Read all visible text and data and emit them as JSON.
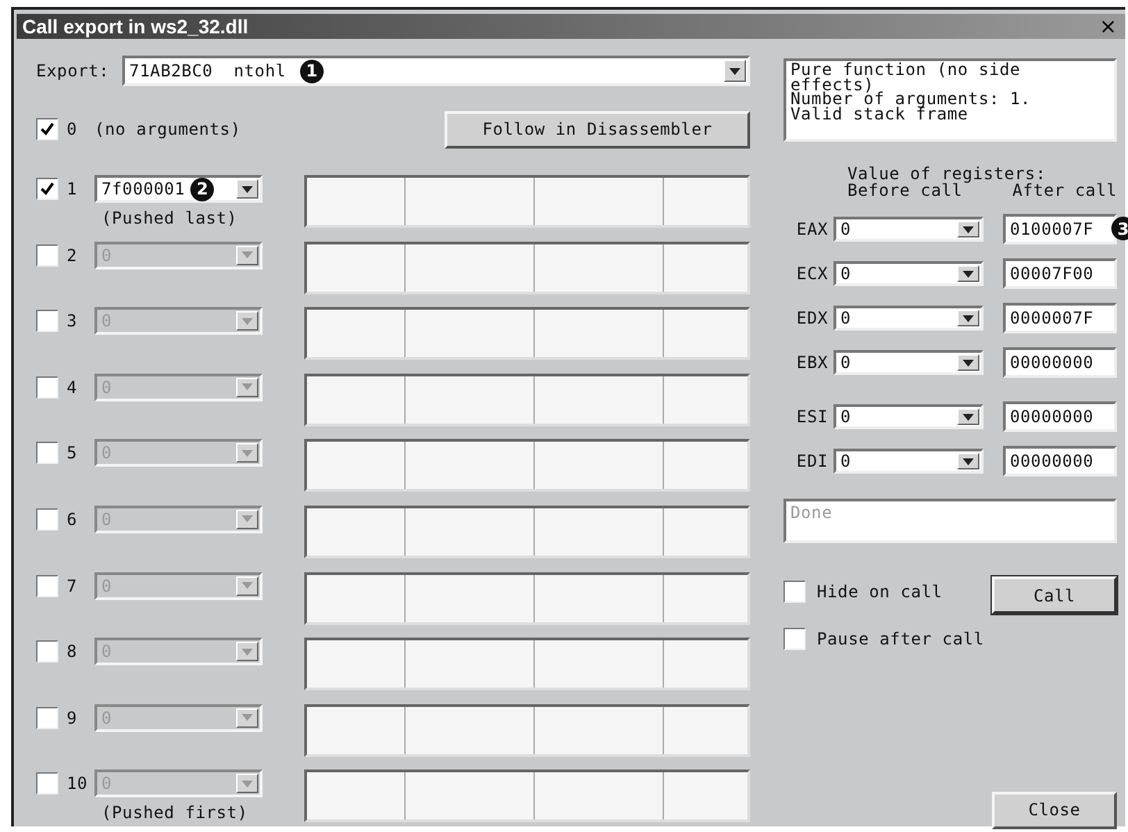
{
  "window": {
    "title": "Call export in ws2_32.dll",
    "close": "×"
  },
  "export": {
    "label": "Export:",
    "value": "71AB2BC0  ntohl",
    "callout": "1"
  },
  "no_arguments": {
    "checked": true,
    "number": "0",
    "label": "(no arguments)"
  },
  "follow_button": "Follow in Disassembler",
  "arguments": [
    {
      "number": "1",
      "checked": true,
      "disabled": false,
      "value": "7f000001",
      "note": "(Pushed last)",
      "callout": "2"
    },
    {
      "number": "2",
      "checked": false,
      "disabled": true,
      "value": "0"
    },
    {
      "number": "3",
      "checked": false,
      "disabled": true,
      "value": "0"
    },
    {
      "number": "4",
      "checked": false,
      "disabled": true,
      "value": "0"
    },
    {
      "number": "5",
      "checked": false,
      "disabled": true,
      "value": "0"
    },
    {
      "number": "6",
      "checked": false,
      "disabled": true,
      "value": "0"
    },
    {
      "number": "7",
      "checked": false,
      "disabled": true,
      "value": "0"
    },
    {
      "number": "8",
      "checked": false,
      "disabled": true,
      "value": "0"
    },
    {
      "number": "9",
      "checked": false,
      "disabled": true,
      "value": "0"
    },
    {
      "number": "10",
      "checked": false,
      "disabled": true,
      "value": "0",
      "note": "(Pushed first)"
    }
  ],
  "info": [
    "Pure function (no side",
    "effects)",
    "Number of arguments: 1.",
    "Valid stack frame"
  ],
  "registers_header": {
    "title": "Value of registers:",
    "before": "Before call",
    "after": "After call"
  },
  "registers": [
    {
      "name": "EAX",
      "before": "0",
      "after": "0100007F",
      "callout": "3"
    },
    {
      "name": "ECX",
      "before": "0",
      "after": "00007F00"
    },
    {
      "name": "EDX",
      "before": "0",
      "after": "0000007F"
    },
    {
      "name": "EBX",
      "before": "0",
      "after": "00000000"
    },
    {
      "name": "ESI",
      "before": "0",
      "after": "00000000"
    },
    {
      "name": "EDI",
      "before": "0",
      "after": "00000000"
    }
  ],
  "status": "Done",
  "options": [
    {
      "label": "Hide on call",
      "checked": false
    },
    {
      "label": "Pause after call",
      "checked": false
    }
  ],
  "call_button": "Call",
  "close_button": "Close"
}
